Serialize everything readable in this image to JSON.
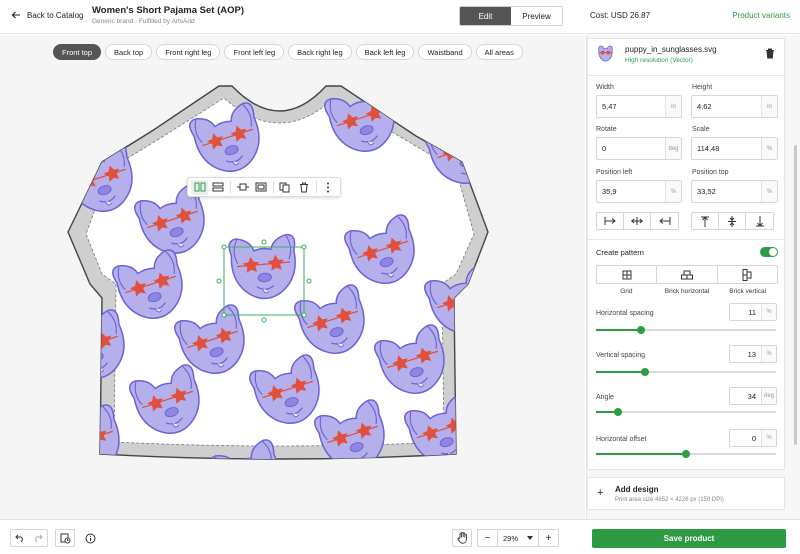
{
  "header": {
    "back_label": "Back to Catalog",
    "title": "Women's Short Pajama Set (AOP)",
    "subtitle": "Generic brand · Fulfilled by ArtsAdd",
    "mode_edit": "Edit",
    "mode_preview": "Preview",
    "cost": "Cost: USD 26.87",
    "variants_link": "Product variants"
  },
  "tabs": [
    "Front top",
    "Back top",
    "Front right leg",
    "Front left leg",
    "Back right leg",
    "Back left leg",
    "Waistband",
    "All areas"
  ],
  "active_tab": "Front top",
  "layer": {
    "filename": "puppy_in_sunglasses.svg",
    "quality": "High resolution (Vector)"
  },
  "fields": {
    "width": {
      "label": "Width",
      "value": "5,47",
      "unit": "in"
    },
    "height": {
      "label": "Height",
      "value": "4,62",
      "unit": "in"
    },
    "rotate": {
      "label": "Rotate",
      "value": "0",
      "unit": "deg"
    },
    "scale": {
      "label": "Scale",
      "value": "114,48",
      "unit": "%"
    },
    "pos_left": {
      "label": "Position left",
      "value": "35,9",
      "unit": "%"
    },
    "pos_top": {
      "label": "Position top",
      "value": "33,52",
      "unit": "%"
    }
  },
  "pattern": {
    "title": "Create pattern",
    "enabled": true,
    "options": [
      "Grid",
      "Brick horizontal",
      "Brick vertical"
    ],
    "h_spacing": {
      "label": "Horizontal spacing",
      "value": "11",
      "unit": "%",
      "level": 0.25
    },
    "v_spacing": {
      "label": "Vertical spacing",
      "value": "13",
      "unit": "%",
      "level": 0.27
    },
    "angle": {
      "label": "Angle",
      "value": "34",
      "unit": "deg",
      "level": 0.12
    },
    "h_offset": {
      "label": "Horizontal offset",
      "value": "0",
      "unit": "%",
      "level": 0.5
    }
  },
  "add_design": {
    "title": "Add design",
    "subtitle": "Print area size 4852 × 4226 px (150 DPI)"
  },
  "zoom": "29%",
  "save_label": "Save product",
  "colors": {
    "accent": "#2e9b44",
    "dog_fill": "#b5b0ec",
    "dog_stroke": "#6b63d6",
    "star": "#e0503c"
  }
}
